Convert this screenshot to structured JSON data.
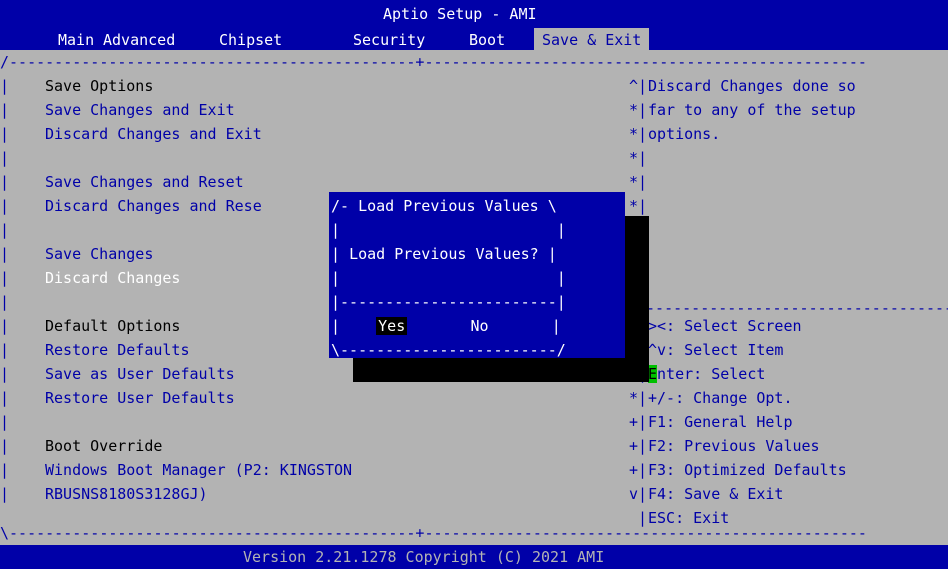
{
  "header": {
    "title": "Aptio Setup - AMI",
    "tabs": [
      "Main",
      "Advanced",
      "Chipset",
      "Security",
      "Boot",
      "Save & Exit"
    ],
    "active_tab": "Save & Exit"
  },
  "left_menu": {
    "save_options_title": "Save Options",
    "save_changes_and_exit": "Save Changes and Exit",
    "discard_changes_and_exit": "Discard Changes and Exit",
    "save_changes_and_reset": "Save Changes and Reset",
    "discard_changes_and_reset_visible": "Discard Changes and Rese",
    "save_changes": "Save Changes",
    "discard_changes": "Discard Changes",
    "default_options_title": "Default Options",
    "restore_defaults": "Restore Defaults",
    "save_as_user_defaults": "Save as User Defaults",
    "restore_user_defaults": "Restore User Defaults",
    "boot_override_title": "Boot Override",
    "boot_item_line1": "Windows Boot Manager (P2: KINGSTON",
    "boot_item_line2": "RBUSNS8180S3128GJ)"
  },
  "help_panel": {
    "line1": "Discard Changes done so",
    "line2": "far to any of the setup",
    "line3": "options."
  },
  "key_help": {
    "select_screen": "><: Select Screen",
    "select_item": "^v: Select Item",
    "enter_select": "nter: Select",
    "enter_key_letter": "E",
    "change_opt": "+/-: Change Opt.",
    "general_help": "F1: General Help",
    "previous_values": "F2: Previous Values",
    "optimized_defaults": "F3: Optimized Defaults",
    "save_exit": "F4: Save & Exit",
    "esc_exit": "ESC: Exit"
  },
  "dialog": {
    "title": "Load Previous Values",
    "message": "Load Previous Values?",
    "yes_label": "Yes",
    "no_label": "No"
  },
  "footer": {
    "version": "Version 2.21.1278 Copyright (C) 2021 AMI"
  }
}
